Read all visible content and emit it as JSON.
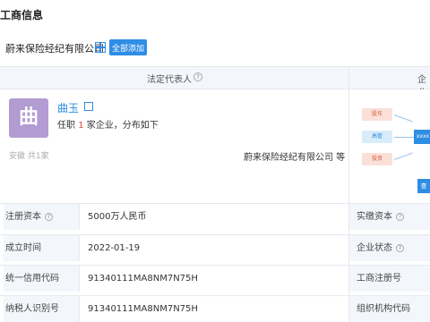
{
  "section_title": "工商信息",
  "company": {
    "name": "蔚来保险经纪有限公司",
    "all_button": "全部添加"
  },
  "table_head": {
    "legal_rep_label": "法定代表人",
    "help_glyph": "?",
    "right_label": "企业"
  },
  "person": {
    "avatar_char": "曲",
    "name": "曲玉",
    "desc_prefix": "任职",
    "desc_count": "1",
    "desc_suffix": "家企业，分布如下",
    "foot": "安徽 共1家",
    "company": "蔚来保险经纪有限公司 等"
  },
  "graph": {
    "node1": "股东",
    "node2": "高管",
    "node3": "投资",
    "center": "xxxx",
    "side_button": "查"
  },
  "rows": [
    {
      "label": "注册资本",
      "help": true,
      "value": "5000万人民币",
      "right_label": "实缴资本",
      "right_help": true
    },
    {
      "label": "成立时间",
      "help": false,
      "value": "2022-01-19",
      "right_label": "企业状态",
      "right_help": true
    },
    {
      "label": "统一信用代码",
      "help": false,
      "value": "91340111MA8NM7N75H",
      "right_label": "工商注册号",
      "right_help": false
    },
    {
      "label": "纳税人识别号",
      "help": false,
      "value": "91340111MA8NM7N75H",
      "right_label": "组织机构代码",
      "right_help": false
    }
  ]
}
